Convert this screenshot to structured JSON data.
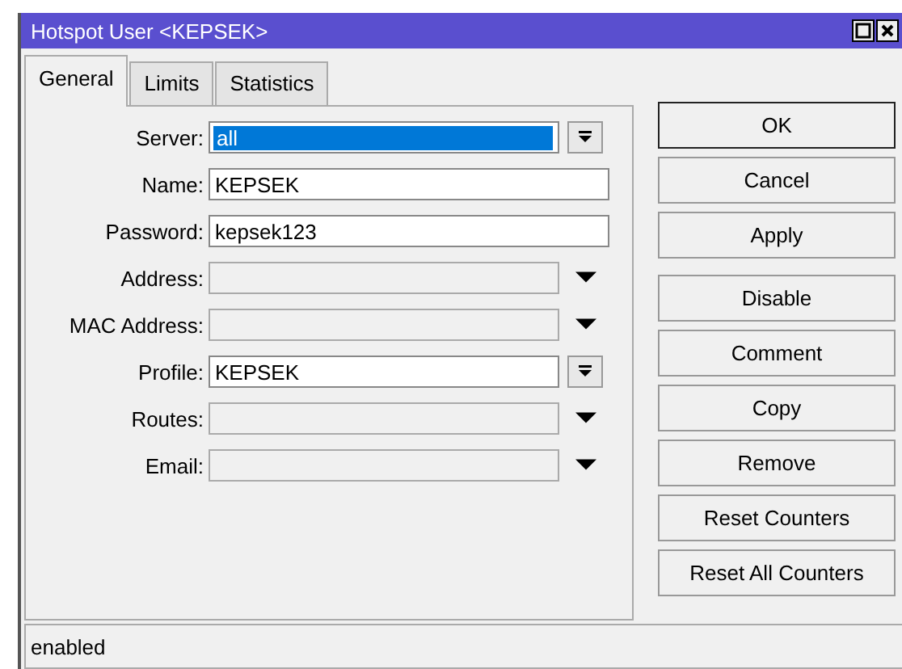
{
  "window": {
    "title": "Hotspot User <KEPSEK>"
  },
  "tabs": [
    {
      "label": "General",
      "selected": true
    },
    {
      "label": "Limits",
      "selected": false
    },
    {
      "label": "Statistics",
      "selected": false
    }
  ],
  "fields": [
    {
      "label": "Server:",
      "kind": "dropdown",
      "value": "all",
      "highlighted": true
    },
    {
      "label": "Name:",
      "kind": "text",
      "value": "KEPSEK"
    },
    {
      "label": "Password:",
      "kind": "text",
      "value": "kepsek123"
    },
    {
      "label": "Address:",
      "kind": "empty-dropdown"
    },
    {
      "label": "MAC Address:",
      "kind": "empty-dropdown"
    },
    {
      "label": "Profile:",
      "kind": "dropdown",
      "value": "KEPSEK",
      "highlighted": false
    },
    {
      "label": "Routes:",
      "kind": "empty-dropdown"
    },
    {
      "label": "Email:",
      "kind": "empty-dropdown"
    }
  ],
  "button_groups": [
    [
      {
        "label": "OK",
        "default": true
      },
      {
        "label": "Cancel",
        "default": false
      },
      {
        "label": "Apply",
        "default": false
      }
    ],
    [
      {
        "label": "Disable",
        "default": false
      },
      {
        "label": "Comment",
        "default": false
      },
      {
        "label": "Copy",
        "default": false
      },
      {
        "label": "Remove",
        "default": false
      },
      {
        "label": "Reset Counters",
        "default": false
      },
      {
        "label": "Reset All Counters",
        "default": false
      }
    ]
  ],
  "status_bar": "enabled"
}
